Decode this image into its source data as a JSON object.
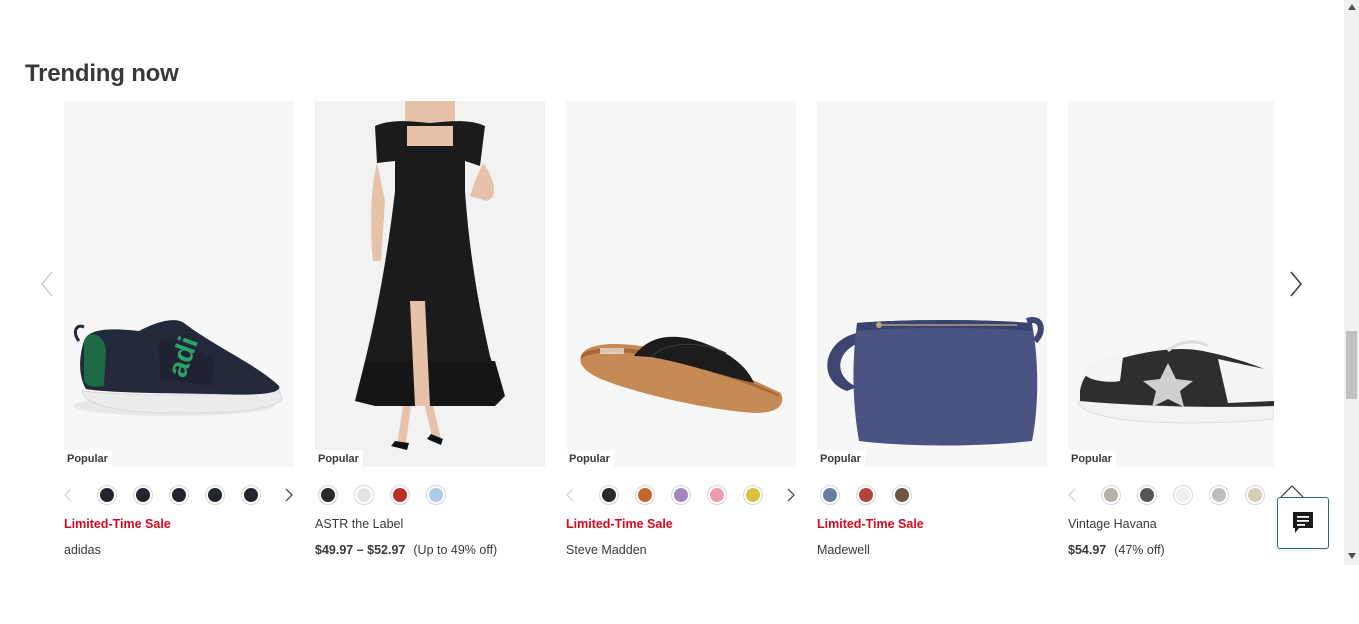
{
  "section": {
    "title": "Trending now"
  },
  "products": [
    {
      "badge": "Popular",
      "sale_label": "Limited-Time Sale",
      "brand": "adidas",
      "swatches": [
        "#22252b",
        "#22252b",
        "#22252b",
        "#22252b",
        "#22252b"
      ]
    },
    {
      "badge": "Popular",
      "brand": "ASTR the Label",
      "price": "$49.97 – $52.97",
      "discount": "(Up to 49% off)",
      "swatches": [
        "#2a2a2a",
        "#e3e3e1",
        "#b8302d",
        "#aecbe8"
      ]
    },
    {
      "badge": "Popular",
      "sale_label": "Limited-Time Sale",
      "brand": "Steve Madden",
      "swatches": [
        "#2a2a2a",
        "#c7662a",
        "#a587bd",
        "#ec9cae",
        "#d9c23a"
      ]
    },
    {
      "badge": "Popular",
      "sale_label": "Limited-Time Sale",
      "brand": "Madewell",
      "swatches": [
        "#6a7ea3",
        "#b0443a",
        "#6a5642"
      ]
    },
    {
      "badge": "Popular",
      "brand": "Vintage Havana",
      "price": "$54.97",
      "discount": "(47% off)",
      "swatches": [
        "#b5b0aa",
        "#555555",
        "#efefef",
        "#bdbdbd",
        "#d6cdb7"
      ]
    }
  ],
  "colors": {
    "sale": "#d50a1e",
    "text": "#393939",
    "chat_border": "#2c6b7a"
  },
  "icons": {
    "carousel_prev": "chevron-left-icon",
    "carousel_next": "chevron-right-icon",
    "chat": "chat-icon",
    "back_to_top": "chevron-up-icon"
  }
}
